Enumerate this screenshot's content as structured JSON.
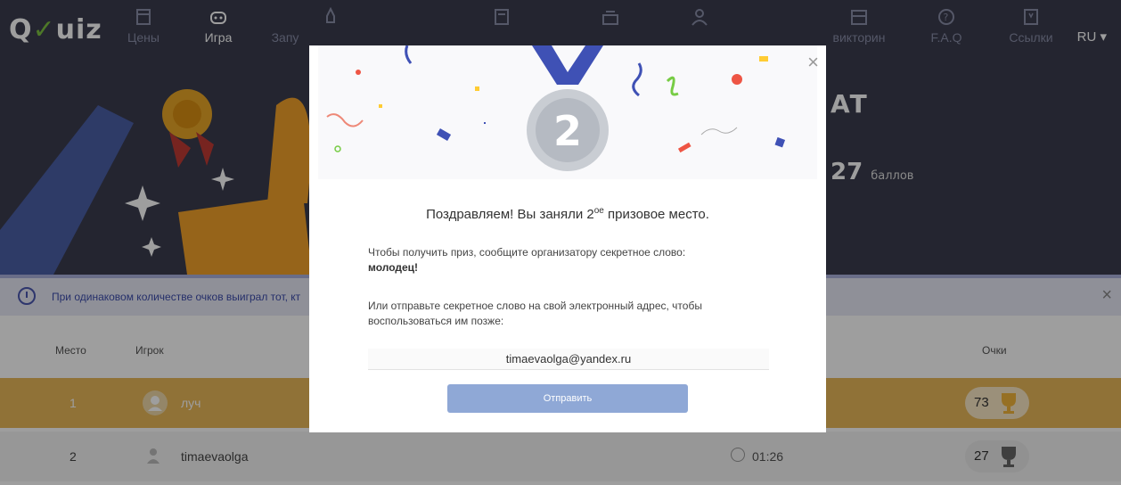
{
  "nav": {
    "logo_a": "Q",
    "logo_b": "uiz",
    "items": [
      {
        "label": "Цены",
        "icon": "tag-icon"
      },
      {
        "label": "Игра",
        "icon": "gamepad-icon",
        "active": true
      },
      {
        "label": "Запу",
        "icon": "rocket-icon"
      },
      {
        "label": "",
        "icon": "document-icon"
      },
      {
        "label": "",
        "icon": "inbox-icon"
      },
      {
        "label": "",
        "icon": "user-icon"
      },
      {
        "label": "викторин",
        "icon": "catalog-icon"
      },
      {
        "label": "F.A.Q",
        "icon": "question-icon"
      },
      {
        "label": "Ссылки",
        "icon": "bookmark-icon"
      }
    ],
    "lang": "RU ▾"
  },
  "hero": {
    "right_fragment": "АТ",
    "score_value": "27",
    "score_unit": "баллов"
  },
  "info": {
    "text": "При одинаковом количестве очков выиграл тот, кт"
  },
  "table": {
    "col_place": "Место",
    "col_player": "Игрок",
    "col_points": "Очки",
    "rows": [
      {
        "place": "1",
        "player": "луч",
        "time": "",
        "points": "73"
      },
      {
        "place": "2",
        "player": "timaevaolga",
        "time": "01:26",
        "points": "27"
      }
    ]
  },
  "modal": {
    "medal_number": "2",
    "title_pre": "Поздравляем! Вы заняли 2",
    "title_sup": "ое",
    "title_post": " призовое место.",
    "p1": "Чтобы получить приз, сообщите организатору секретное слово:",
    "secret": "молодец!",
    "p2": "Или отправьте секретное слово на свой электронный адрес, чтобы воспользоваться им позже:",
    "email_value": "timaevaolga@yandex.ru",
    "send_label": "Отправить",
    "close": "×"
  },
  "colors": {
    "nav_bg": "#3a3c4e",
    "row_gold": "#e9b95a",
    "button": "#8fa8d6"
  }
}
